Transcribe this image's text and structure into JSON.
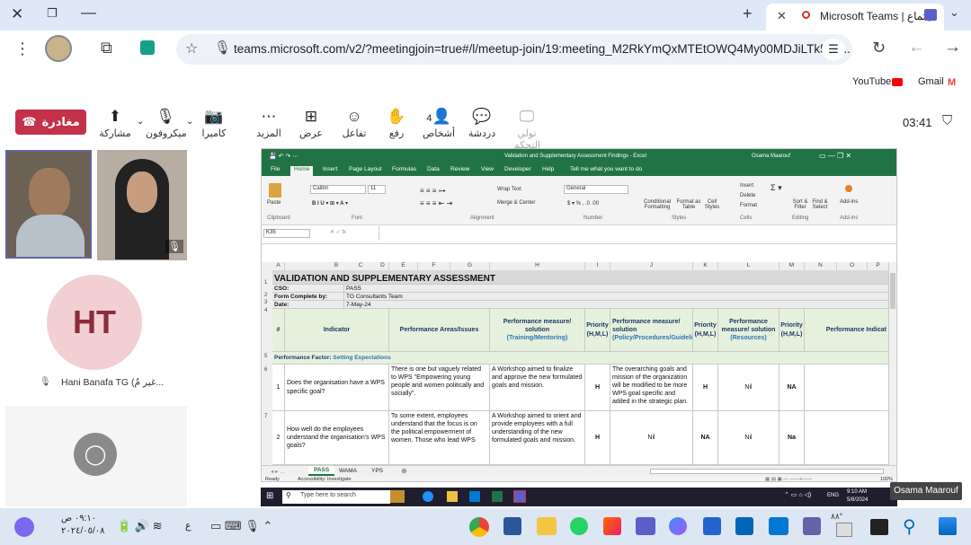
{
  "browser": {
    "tab_title": "Microsoft Teams | اجتماع",
    "url": "teams.microsoft.com/v2/?meetingjoin=true#/l/meetup-join/19:meeting_M2RkYmQxMTEtOWQ4My00MDJiLTk5ZT...",
    "bookmarks": [
      "YouTube",
      "Gmail"
    ]
  },
  "teams": {
    "leave": "مغادرة",
    "timer": "03:41",
    "people_count": "4",
    "tools": [
      {
        "id": "share",
        "label": "مشاركة",
        "icon": "⬆"
      },
      {
        "id": "mic",
        "label": "ميكروفون",
        "icon": "🎙"
      },
      {
        "id": "camera",
        "label": "كاميرا",
        "icon": "📷"
      },
      {
        "id": "more",
        "label": "المزيد",
        "icon": "⋯"
      },
      {
        "id": "view",
        "label": "عرض",
        "icon": "⊞"
      },
      {
        "id": "react",
        "label": "تفاعل",
        "icon": "☺"
      },
      {
        "id": "raise",
        "label": "رفع",
        "icon": "✋"
      },
      {
        "id": "people",
        "label": "أشخاص",
        "icon": "👤"
      },
      {
        "id": "chat",
        "label": "دردشة",
        "icon": "💬"
      },
      {
        "id": "control",
        "label": "تولي التحكم",
        "icon": "🖵"
      }
    ],
    "participants": {
      "avatar_initials": "HT",
      "avatar_name": "Hani Banafa TG (غير مُ..."
    }
  },
  "excel": {
    "title": "Validation and Supplementary Assessment Findings - Excel",
    "user": "Osama Maarouf",
    "menu": [
      "File",
      "Home",
      "Insert",
      "Page Layout",
      "Formulas",
      "Data",
      "Review",
      "View",
      "Developer",
      "Help",
      "Tell me what you want to do"
    ],
    "font": "Calibri",
    "font_size": "11",
    "number_format": "General",
    "ribbon_groups": [
      "Clipboard",
      "Font",
      "Alignment",
      "Number",
      "Styles",
      "Cells",
      "Editing",
      "Add-ins"
    ],
    "ribbon_items": {
      "paste": "Paste",
      "wrap": "Wrap Text",
      "merge": "Merge & Center",
      "cond": "Conditional Formatting",
      "table": "Format as Table",
      "styles": "Cell Styles",
      "insert": "Insert",
      "delete": "Delete",
      "format": "Format",
      "sort": "Sort & Filter",
      "find": "Find & Select",
      "addins": "Add-ins"
    },
    "name_box": "K35",
    "columns": [
      "A",
      "B",
      "C",
      "D",
      "E",
      "F",
      "G",
      "H",
      "I",
      "J",
      "K",
      "L",
      "M",
      "N",
      "O",
      "P"
    ],
    "sheet_title": "VALIDATION AND SUPPLEMENTARY ASSESSMENT",
    "meta": [
      {
        "k": "CSO:",
        "v": "PASS"
      },
      {
        "k": "Form Complete by:",
        "v": "TG Consultants Team"
      },
      {
        "k": "Date:",
        "v": "7-May-24"
      }
    ],
    "headers": {
      "num": "#",
      "indicator": "Indicator",
      "areas": "Performance Areas/Issues",
      "training_a": "Performance measure/ solution",
      "training_b": "(Training/Mentoring)",
      "p1": "Priority (H,M,L)",
      "policy_a": "Performance measure/ solution",
      "policy_b": "(Policy/Procedures/Guidelines/Tools)",
      "p2": "Priority (H,M,L)",
      "res_a": "Performance measure/ solution",
      "res_b": "(Resources)",
      "p3": "Priority (H,M,L)",
      "ind2": "Performance Indicat"
    },
    "factor_label": "Performance Factor:",
    "factor_value": "Setting Expectations",
    "rows": [
      {
        "n": "1",
        "indicator": "Does the organisation have a WPS specific goal?",
        "areas": "There is one but vaguely related to WPS \"Empowering young people and women politically and socially\".",
        "training": "A Workshop aimed to finalize and approve the new formulated goals and mission.",
        "p1": "H",
        "policy": "The overarching goals and mission of the organization will be modified to be more WPS goal specific and added in the strategic plan.",
        "p2": "H",
        "res": "Nil",
        "p3": "NA"
      },
      {
        "n": "2",
        "indicator": "How well do the employees understand the organisation's WPS goals?",
        "areas": "To some extent, employees understand that the focus is on the political empowerment of women. Those who lead WPS",
        "training": "A Workshop aimed to orient and provide employees with a full understanding of the new formulated goals and mission.",
        "p1": "H",
        "policy": "Nil",
        "p2": "NA",
        "res": "Nil",
        "p3": "Na"
      }
    ],
    "row_numbers": [
      "1",
      "2",
      "3",
      "4",
      "5",
      "6",
      "7"
    ],
    "sheets": [
      "PASS",
      "WAMA",
      "YPS"
    ],
    "status": "Ready",
    "accessibility": "Accessibility: Investigate",
    "zoom": "100%"
  },
  "inner_taskbar": {
    "search": "Type here to search",
    "time": "9:10 AM",
    "date": "5/8/2024",
    "lang": "ENG"
  },
  "presenter": "Osama Maarouf",
  "os": {
    "time": "٠٩:١٠ ص",
    "date": "٢٠٢٤/٠٥/٠٨",
    "lang": "ع",
    "weather": "٨٨°"
  }
}
